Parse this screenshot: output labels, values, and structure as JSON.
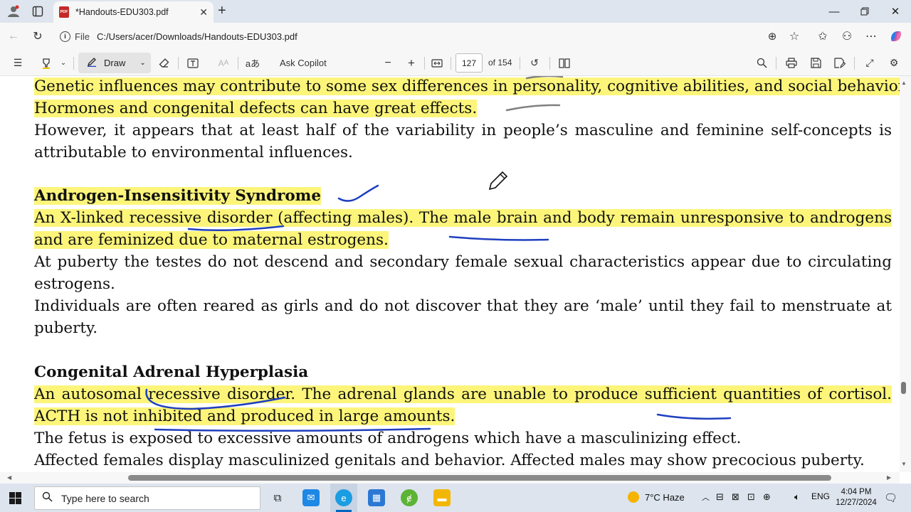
{
  "browser": {
    "tab_title": "*Handouts-EDU303.pdf",
    "tab_badge": "PDF",
    "url_label": "File",
    "url": "C:/Users/acer/Downloads/Handouts-EDU303.pdf"
  },
  "pdf_toolbar": {
    "draw_label": "Draw",
    "ask_copilot_label": "Ask Copilot",
    "page_current": "127",
    "page_total": "of 154"
  },
  "document": {
    "lines": [
      "Genetic influences may contribute to some sex differences in personality, cognitive abilities, and social behaviors.",
      "Hormones and congenital defects can have great effects.",
      "However, it appears that at least half of the variability in people’s masculine and feminine self-concepts is",
      "attributable to environmental influences.",
      "Androgen-Insensitivity Syndrome",
      "An X-linked recessive disorder (affecting males). The male brain and body remain unresponsive to androgens",
      "and are feminized due to maternal estrogens.",
      "At puberty the testes do not descend and secondary female sexual characteristics appear due to circulating",
      "estrogens.",
      "Individuals are often reared as girls and do not discover that they are ‘male’ until they fail to menstruate at",
      "puberty.",
      "Congenital Adrenal Hyperplasia",
      "An autosomal recessive disorder. The adrenal glands are unable to produce sufficient quantities of cortisol.",
      "ACTH is not inhibited and produced in large amounts.",
      "The fetus is exposed to excessive amounts of androgens which have a masculinizing effect.",
      "Affected females display masculinized genitals and behavior. Affected males may show precocious puberty."
    ]
  },
  "taskbar": {
    "search_placeholder": "Type here to search",
    "weather": "7°C  Haze",
    "language": "ENG",
    "time": "4:04 PM",
    "date": "12/27/2024"
  },
  "colors": {
    "highlight": "#fcf57a",
    "ink_blue": "#1f3fbf",
    "ink_gray": "#808080"
  }
}
